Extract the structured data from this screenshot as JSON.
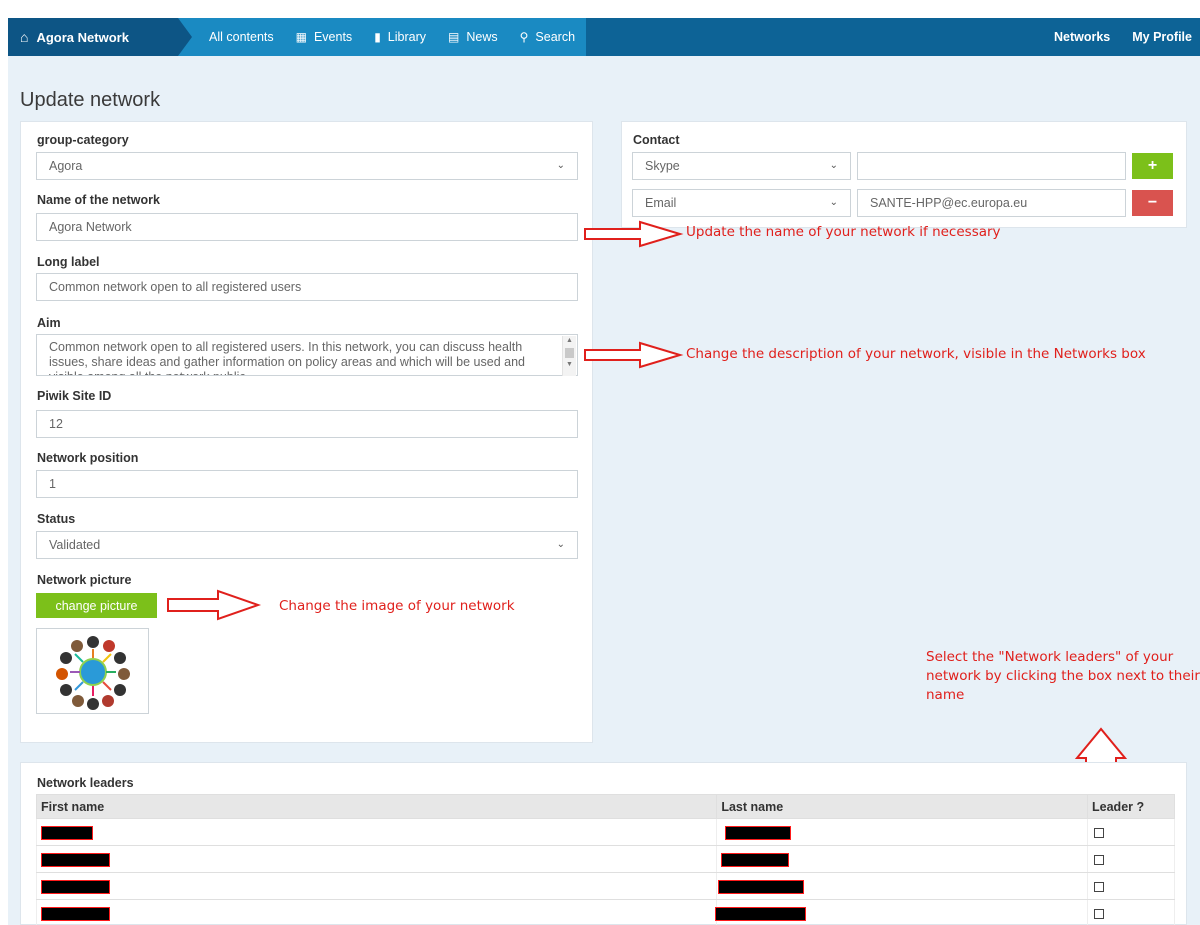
{
  "nav": {
    "brand": "Agora Network",
    "tabs": [
      {
        "label": "All contents"
      },
      {
        "label": "Events"
      },
      {
        "label": "Library"
      },
      {
        "label": "News"
      },
      {
        "label": "Search"
      }
    ],
    "right": [
      "Networks",
      "My Profile"
    ]
  },
  "page_title": "Update network",
  "form": {
    "group_category": {
      "label": "group-category",
      "value": "Agora"
    },
    "name": {
      "label": "Name of the network",
      "value": "Agora Network"
    },
    "long_label": {
      "label": "Long label",
      "value": "Common network open to all registered users"
    },
    "aim": {
      "label": "Aim",
      "value": "Common network open to all registered users. In this network, you can discuss health issues, share ideas and gather information on policy areas and which will be used and visible among all the network public"
    },
    "piwik": {
      "label": "Piwik Site ID",
      "value": "12"
    },
    "position": {
      "label": "Network position",
      "value": "1"
    },
    "status": {
      "label": "Status",
      "value": "Validated"
    },
    "picture": {
      "label": "Network picture",
      "button": "change picture"
    }
  },
  "contact": {
    "label": "Contact",
    "rows": [
      {
        "type": "Skype",
        "value": "",
        "action": "+"
      },
      {
        "type": "Email",
        "value": "SANTE-HPP@ec.europa.eu",
        "action": "−"
      }
    ]
  },
  "annotations": {
    "name": "Update the name of your network if necessary",
    "aim": "Change the description of your network, visible in the Networks box",
    "picture": "Change the image of your network",
    "leaders": "Select the \"Network leaders\" of your network by clicking the box next to their name"
  },
  "leaders": {
    "title": "Network leaders",
    "columns": [
      "First name",
      "Last name",
      "Leader ?"
    ],
    "rows": [
      {
        "checked": false
      },
      {
        "checked": false
      },
      {
        "checked": false
      },
      {
        "checked": false
      }
    ]
  },
  "colors": {
    "nav_dark": "#0d5585",
    "nav_light": "#1a8ac2",
    "green": "#7cc01a",
    "red": "#d9534f",
    "annotation": "#e0201c"
  }
}
